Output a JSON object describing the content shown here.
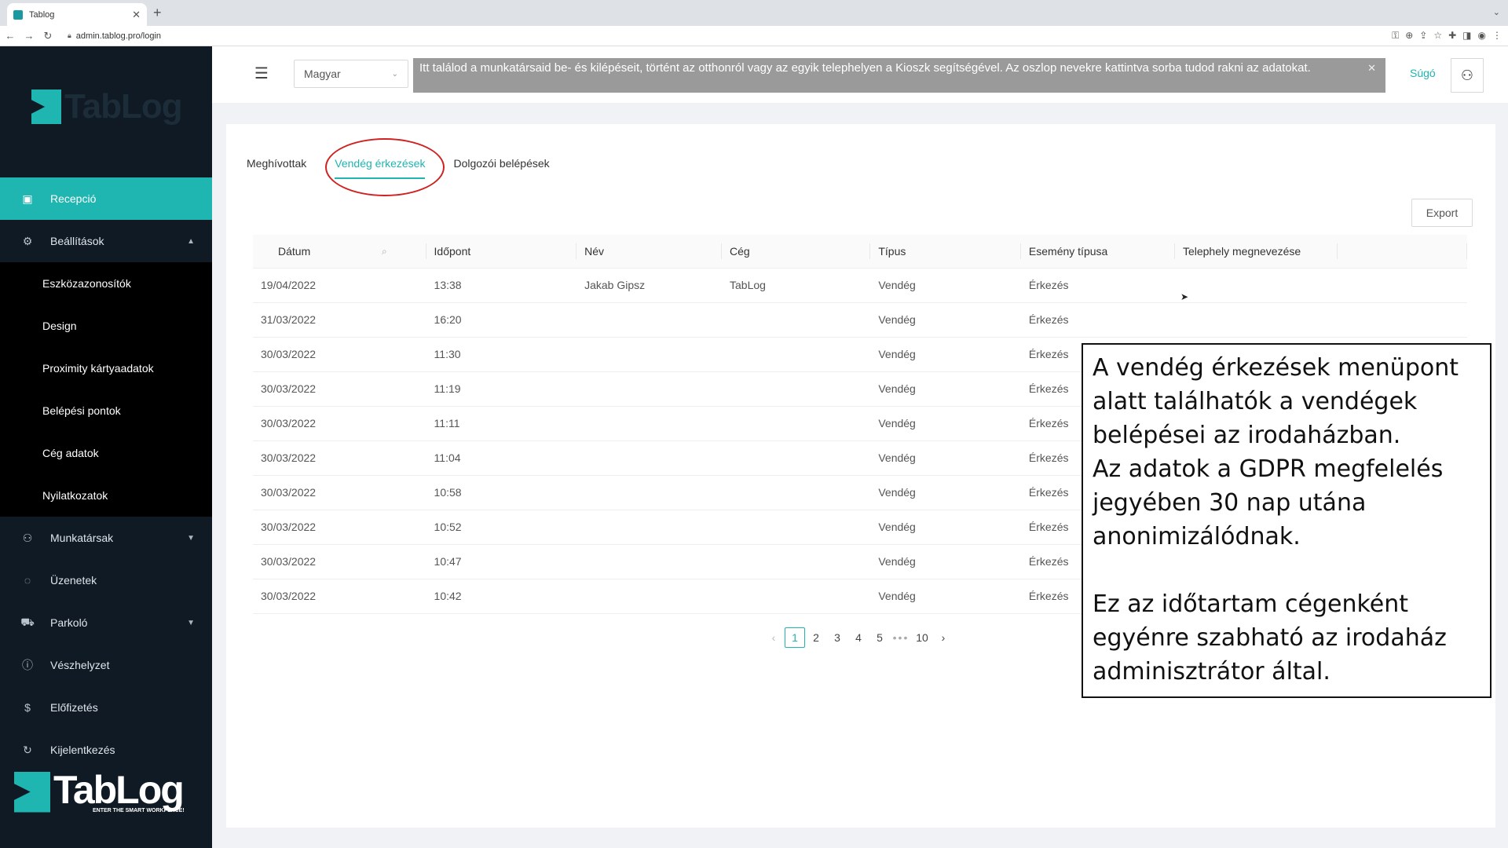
{
  "browser": {
    "tab_title": "Tablog",
    "url": "admin.tablog.pro/login"
  },
  "brand": {
    "logo_text": "TabLog",
    "tagline": "ENTER THE SMART WORKPLACE!",
    "accent": "#1fb5b0",
    "sidebar_bg": "#0f1a24"
  },
  "sidebar": {
    "items": [
      {
        "label": "Recepció",
        "icon": "reception-icon",
        "active": true
      },
      {
        "label": "Beállítások",
        "icon": "gear-icon",
        "expanded": true
      },
      {
        "label": "Munkatársak",
        "icon": "person-icon"
      },
      {
        "label": "Üzenetek",
        "icon": "message-icon"
      },
      {
        "label": "Parkoló",
        "icon": "car-icon"
      },
      {
        "label": "Vészhelyzet",
        "icon": "alert-icon"
      },
      {
        "label": "Előfizetés",
        "icon": "coin-icon"
      },
      {
        "label": "Kijelentkezés",
        "icon": "logout-icon"
      }
    ],
    "settings_sub": [
      "Eszközazonosítók",
      "Design",
      "Proximity kártyaadatok",
      "Belépési pontok",
      "Cég adatok",
      "Nyilatkozatok"
    ]
  },
  "header": {
    "language": "Magyar",
    "notice": "Itt találod a munkatársaid be- és kilépéseit, történt az otthonról vagy az egyik telephelyen a Kioszk segítségével. Az oszlop nevekre kattintva sorba tudod rakni az adatokat.",
    "help": "Súgó"
  },
  "tabs": [
    {
      "label": "Meghívottak",
      "active": false
    },
    {
      "label": "Vendég érkezések",
      "active": true
    },
    {
      "label": "Dolgozói belépések",
      "active": false
    }
  ],
  "export_label": "Export",
  "table": {
    "columns": [
      "Dátum",
      "Időpont",
      "Név",
      "Cég",
      "Típus",
      "Esemény típusa",
      "Telephely megnevezése",
      ""
    ],
    "rows": [
      [
        "19/04/2022",
        "13:38",
        "Jakab Gipsz",
        "TabLog",
        "Vendég",
        "Érkezés",
        ""
      ],
      [
        "31/03/2022",
        "16:20",
        "",
        "",
        "Vendég",
        "Érkezés",
        ""
      ],
      [
        "30/03/2022",
        "11:30",
        "",
        "",
        "Vendég",
        "Érkezés",
        ""
      ],
      [
        "30/03/2022",
        "11:19",
        "",
        "",
        "Vendég",
        "Érkezés",
        ""
      ],
      [
        "30/03/2022",
        "11:11",
        "",
        "",
        "Vendég",
        "Érkezés",
        ""
      ],
      [
        "30/03/2022",
        "11:04",
        "",
        "",
        "Vendég",
        "Érkezés",
        ""
      ],
      [
        "30/03/2022",
        "10:58",
        "",
        "",
        "Vendég",
        "Érkezés",
        ""
      ],
      [
        "30/03/2022",
        "10:52",
        "",
        "",
        "Vendég",
        "Érkezés",
        ""
      ],
      [
        "30/03/2022",
        "10:47",
        "",
        "",
        "Vendég",
        "Érkezés",
        ""
      ],
      [
        "30/03/2022",
        "10:42",
        "",
        "",
        "Vendég",
        "Érkezés",
        ""
      ]
    ]
  },
  "pagination": {
    "current": "1",
    "pages": [
      "1",
      "2",
      "3",
      "4",
      "5",
      "•••",
      "10"
    ]
  },
  "annotation": {
    "lines_a": [
      "A vendég érkezések menüpont",
      "alatt találhatók a vendégek",
      "belépései az irodaházban.",
      "Az adatok a GDPR megfelelés",
      "jegyében 30 nap utána",
      "anonimizálódnak."
    ],
    "lines_b": [
      "Ez az időtartam cégenként",
      "egyénre szabható az irodaház",
      "adminisztrátor által."
    ]
  }
}
